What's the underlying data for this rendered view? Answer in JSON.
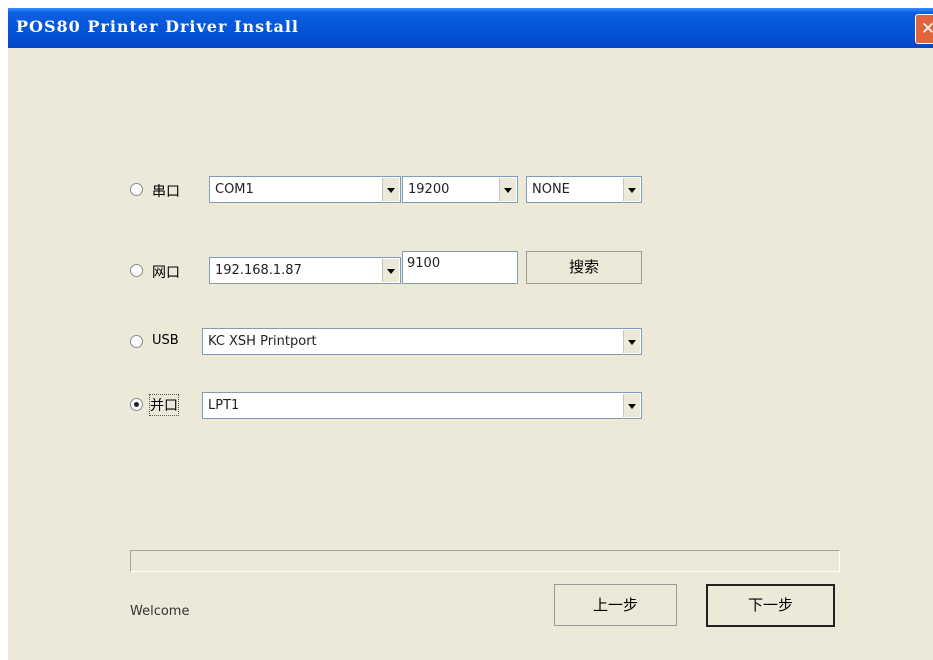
{
  "window": {
    "title": "POS80 Printer Driver Install",
    "close_glyph": "✕"
  },
  "ports": {
    "serial": {
      "label": "串口",
      "selected": false,
      "port": "COM1",
      "baud": "19200",
      "parity": "NONE"
    },
    "network": {
      "label": "网口",
      "selected": false,
      "ip": "192.168.1.87",
      "port": "9100",
      "search_label": "搜索"
    },
    "usb": {
      "label": "USB",
      "selected": false,
      "device": "KC XSH Printport"
    },
    "parallel": {
      "label": "并口",
      "selected": true,
      "port": "LPT1"
    }
  },
  "progress": {
    "fraction": 0
  },
  "status_text": "Welcome",
  "buttons": {
    "back_label": "上一步",
    "next_label": "下一步"
  },
  "colors": {
    "titlebar": "#0555d8",
    "window_bg": "#ece9d8",
    "close_button": "#e0643c"
  }
}
